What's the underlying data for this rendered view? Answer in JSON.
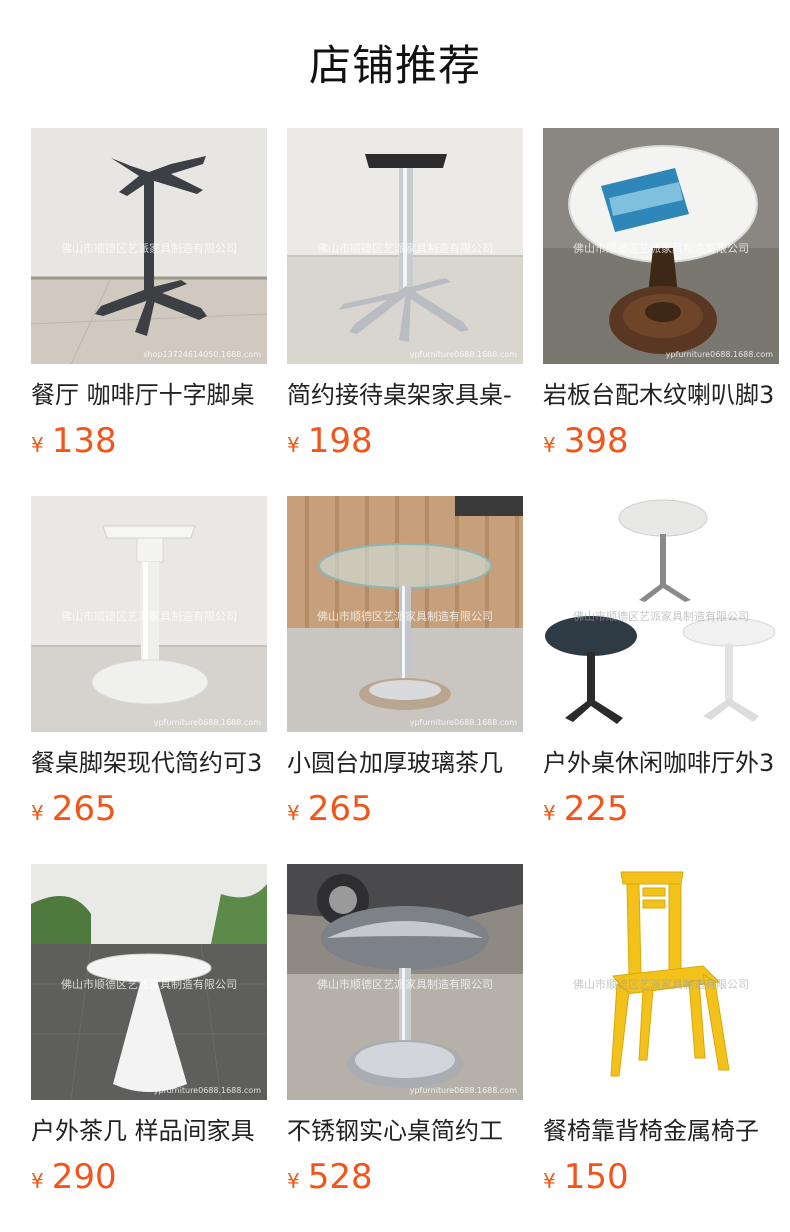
{
  "header": {
    "title": "店铺推荐"
  },
  "products": [
    {
      "name": "餐厅 咖啡厅十字脚桌",
      "currency": "¥",
      "price": "138",
      "watermark": "佛山市顺德区艺派家具制造有限公司",
      "url": "shop13724614050.1688.com"
    },
    {
      "name": "简约接待桌架家具桌-",
      "currency": "¥",
      "price": "198",
      "watermark": "佛山市顺德区艺派家具制造有限公司",
      "url": "ypfurniture0688.1688.com"
    },
    {
      "name": "岩板台配木纹喇叭脚3",
      "currency": "¥",
      "price": "398",
      "watermark": "佛山市顺德区艺派家具制造有限公司",
      "url": "ypfurniture0688.1688.com"
    },
    {
      "name": "餐桌脚架现代简约可3",
      "currency": "¥",
      "price": "265",
      "watermark": "佛山市顺德区艺派家具制造有限公司",
      "url": "ypfurniture0688.1688.com"
    },
    {
      "name": "小圆台加厚玻璃茶几",
      "currency": "¥",
      "price": "265",
      "watermark": "佛山市顺德区艺派家具制造有限公司",
      "url": "ypfurniture0688.1688.com"
    },
    {
      "name": "户外桌休闲咖啡厅外3",
      "currency": "¥",
      "price": "225",
      "watermark": "佛山市顺德区艺派家具制造有限公司",
      "url": ""
    },
    {
      "name": "户外茶几 样品间家具",
      "currency": "¥",
      "price": "290",
      "watermark": "佛山市顺德区艺派家具制造有限公司",
      "url": "ypfurniture0688.1688.com"
    },
    {
      "name": "不锈钢实心桌简约工",
      "currency": "¥",
      "price": "528",
      "watermark": "佛山市顺德区艺派家具制造有限公司",
      "url": "ypfurniture0688.1688.com"
    },
    {
      "name": "餐椅靠背椅金属椅子",
      "currency": "¥",
      "price": "150",
      "watermark": "佛山市顺德区艺派家具制造有限公司",
      "url": ""
    }
  ]
}
